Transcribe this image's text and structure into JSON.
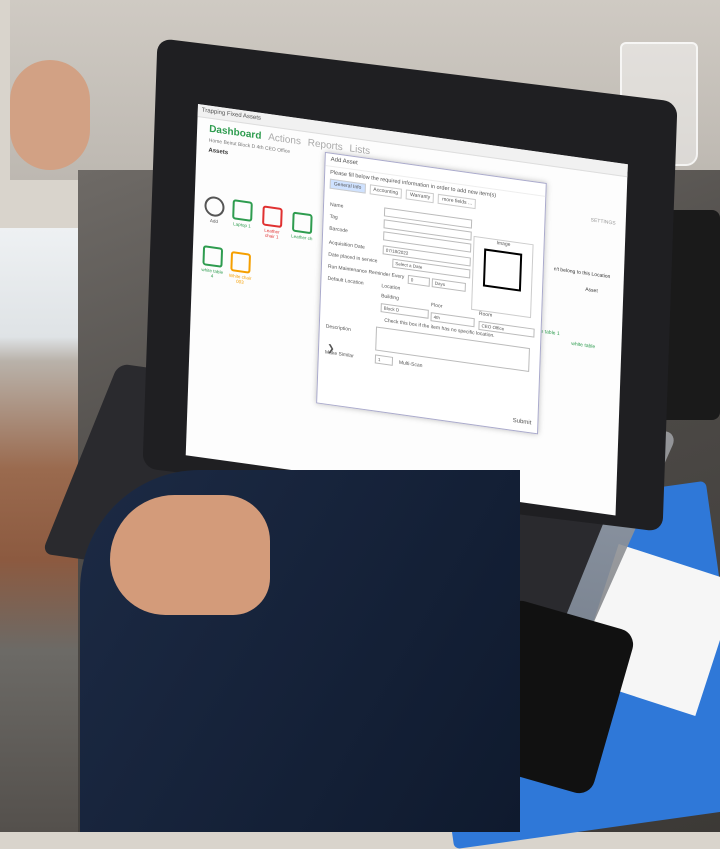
{
  "app": {
    "window_title": "Trapping Fixed Assets",
    "nav": {
      "active": "Dashboard",
      "others": [
        "Actions",
        "Reports",
        "Lists"
      ],
      "breadcrumb": [
        "Home",
        "Beirut",
        "Block D",
        "4th",
        "CEO Office"
      ],
      "section_title": "Assets",
      "settings_label": "SETTINGS"
    },
    "tiles": [
      {
        "label": "Add",
        "color": "#555555"
      },
      {
        "label": "Laptop 1",
        "color": "#2e9c4f"
      },
      {
        "label": "Leather chair 1",
        "color": "#e03131"
      },
      {
        "label": "Leather ch",
        "color": "#2e9c4f"
      },
      {
        "label": "white table 4",
        "color": "#2e9c4f"
      },
      {
        "label": "White chair 003",
        "color": "#f59f00"
      }
    ],
    "right_labels": {
      "location_note": "n't belong to this Location",
      "add_button": "Asset",
      "table1": "white table 1",
      "table2": "white table"
    },
    "dialog": {
      "title": "Add Asset",
      "instruction": "Please fill below the required information in order to add new item(s)",
      "tabs": [
        "General Info",
        "Accounting",
        "Warranty",
        "more fields ..."
      ],
      "fields": {
        "name": "Name",
        "tag": "Tag",
        "barcode": "Barcode",
        "acquisition_date": "Acquisition Date",
        "acquisition_value": "07/18/2022",
        "date_in_service": "Date placed in service",
        "date_in_service_value": "Select a Date",
        "maintenance": "Run Maintenance Reminder Every",
        "maintenance_value": "0",
        "maintenance_unit": "Days",
        "default_location": "Default Location",
        "location": "Location",
        "building": "Building",
        "building_value": "Block D",
        "floor": "Floor",
        "floor_value": "4th",
        "room": "Room",
        "room_value": "CEO Office",
        "no_location": "Check this box if the item has no specific location.",
        "description": "Description",
        "make_similar": "Make Similar",
        "make_similar_value": "1",
        "multi_scan": "Multi-Scan"
      },
      "image_label": "Image",
      "submit": "Submit"
    }
  }
}
